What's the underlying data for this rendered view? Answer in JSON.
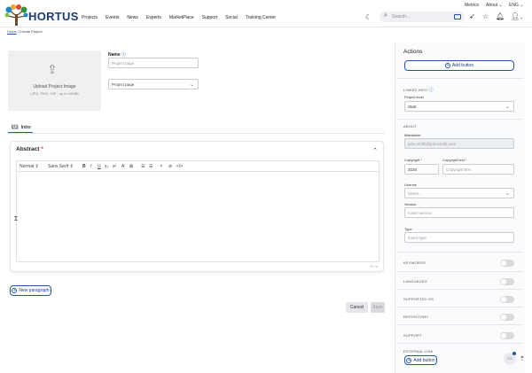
{
  "topbar": {
    "metrics": "Metrics",
    "about": "About",
    "lang": "ENG"
  },
  "brand": {
    "name": "HORTUS"
  },
  "nav": [
    "Projects",
    "Events",
    "News",
    "Experts",
    "MarketPlace",
    "Support",
    "Social",
    "Training Center"
  ],
  "search": {
    "placeholder": "Search..."
  },
  "breadcrumb": {
    "home": "Home",
    "sep": "/",
    "current": "Create Project"
  },
  "upload": {
    "title": "Upload Project Image",
    "hint": "(JPG, PNG, GIF - up to 10MB)"
  },
  "name_field": {
    "label": "Name",
    "placeholder": "Project page"
  },
  "type_select": {
    "value": "Project page"
  },
  "tab": {
    "label": "Intro"
  },
  "abstract": {
    "title": "Abstract",
    "required": "*",
    "toolbar": {
      "style": "Normal",
      "font": "Sans Serif"
    },
    "counter": "0 / ∞"
  },
  "new_paragraph": "New paragraph",
  "cancel": "Cancel",
  "save": "Save",
  "actions": {
    "title": "Actions",
    "add_button": "Add button"
  },
  "linked_info": {
    "title": "LINKED INFO",
    "project_level_label": "Project level",
    "project_level_value": "Start"
  },
  "about": {
    "title": "ABOUT",
    "maintainer_label": "Maintainer",
    "maintainer_value": "john.smith@johnsmith.com",
    "copyright_label": "Copyright",
    "copyright_value": "2026",
    "copyright_text_label": "Copyright text",
    "copyright_text_placeholder": "Copyright text",
    "license_label": "License",
    "license_placeholder": "Select...",
    "version_label": "Version",
    "version_placeholder": "Insert version",
    "type_label": "Type",
    "type_placeholder": "Insert type"
  },
  "toggles": [
    "KEYWORDS",
    "LANGUAGES",
    "SUPPORTED OS",
    "REPOSITORY",
    "SUPPORT"
  ],
  "external_link": {
    "title": "EXTERNAL LINK",
    "add_button": "Add button"
  },
  "colors": {
    "primary": "#2456a8",
    "brand_green": "#3a8f3a"
  }
}
